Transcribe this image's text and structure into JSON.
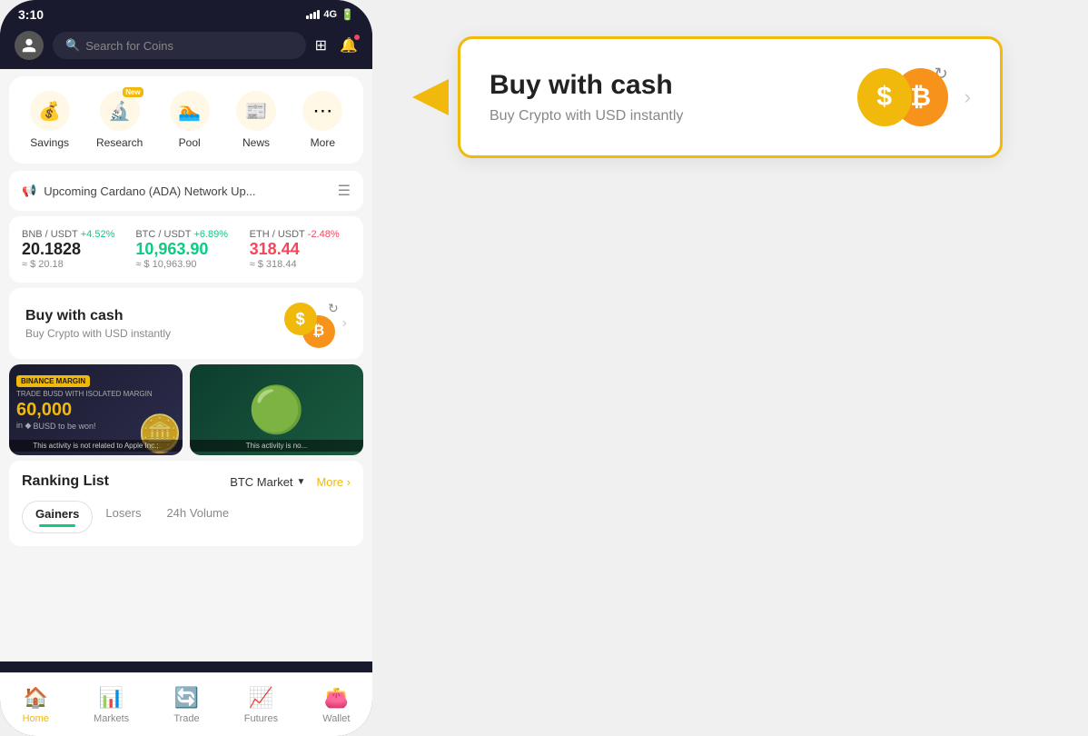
{
  "status": {
    "time": "3:10",
    "signal": "4G",
    "battery": "🔋"
  },
  "search": {
    "placeholder": "Search for Coins"
  },
  "categories": [
    {
      "id": "savings",
      "icon": "💰",
      "label": "Savings",
      "new": false
    },
    {
      "id": "research",
      "icon": "🔬",
      "label": "Research",
      "new": true
    },
    {
      "id": "pool",
      "icon": "🏊",
      "label": "Pool",
      "new": false
    },
    {
      "id": "news",
      "icon": "📰",
      "label": "News",
      "new": false
    },
    {
      "id": "more",
      "icon": "⋯",
      "label": "More",
      "new": false
    }
  ],
  "announcement": {
    "text": "Upcoming Cardano (ADA) Network Up...",
    "icon": "📢"
  },
  "tickers": [
    {
      "pair": "BNB / USDT",
      "change": "+4.52%",
      "positive": true,
      "price": "20.1828",
      "usd": "≈ $ 20.18"
    },
    {
      "pair": "BTC / USDT",
      "change": "+6.89%",
      "positive": true,
      "price": "10,963.90",
      "usd": "≈ $ 10,963.90"
    },
    {
      "pair": "ETH / USDT",
      "change": "-2.48%",
      "positive": false,
      "price": "318.44",
      "usd": "≈ $ 318.44"
    }
  ],
  "buy_banner": {
    "title": "Buy with cash",
    "subtitle": "Buy Crypto with USD instantly"
  },
  "promos": [
    {
      "badge": "BINANCE MARGIN",
      "subtitle": "TRADE BUSD WITH ISOLATED MARGIN",
      "amount": "60,000",
      "currency": "BUSD to be won!",
      "disclaimer": "This activity is not related to Apple Inc.;"
    },
    {
      "disclaimer": "This activity is no..."
    }
  ],
  "ranking": {
    "title": "Ranking List",
    "market": "BTC Market",
    "more": "More",
    "tabs": [
      "Gainers",
      "Losers",
      "24h Volume"
    ],
    "active_tab": 0
  },
  "callout": {
    "title": "Buy with cash",
    "subtitle": "Buy Crypto with USD instantly"
  },
  "nav": [
    {
      "id": "home",
      "icon": "🏠",
      "label": "Home",
      "active": true
    },
    {
      "id": "markets",
      "icon": "📊",
      "label": "Markets",
      "active": false
    },
    {
      "id": "trade",
      "icon": "🔄",
      "label": "Trade",
      "active": false
    },
    {
      "id": "futures",
      "icon": "📈",
      "label": "Futures",
      "active": false
    },
    {
      "id": "wallet",
      "icon": "👛",
      "label": "Wallet",
      "active": false
    }
  ],
  "labels": {
    "new": "New",
    "gainers": "Gainers",
    "losers": "Losers",
    "volume": "24h Volume",
    "more": "More ›"
  }
}
